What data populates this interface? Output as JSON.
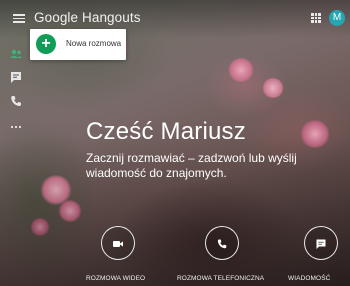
{
  "app": {
    "title": "Google Hangouts",
    "avatar_letter": "M"
  },
  "popup": {
    "new_conversation_label": "Nowa rozmowa"
  },
  "main": {
    "greeting": "Cześć Mariusz",
    "subtitle": "Zacznij rozmawiać – zadzwoń lub wyślij wiadomość do znajomych."
  },
  "actions": [
    {
      "label": "ROZMOWA WIDEO",
      "icon": "video-icon"
    },
    {
      "label": "ROZMOWA TELEFONICZNA",
      "icon": "phone-icon"
    },
    {
      "label": "WIADOMOŚĆ",
      "icon": "message-icon"
    }
  ],
  "rail": [
    {
      "icon": "contacts-icon",
      "active": true
    },
    {
      "icon": "conversations-icon",
      "active": false
    },
    {
      "icon": "phone-icon",
      "active": false
    },
    {
      "icon": "more-icon",
      "active": false
    }
  ],
  "colors": {
    "accent_green": "#0f9d58",
    "avatar": "#26a6b3",
    "text_light": "#ffffff"
  }
}
